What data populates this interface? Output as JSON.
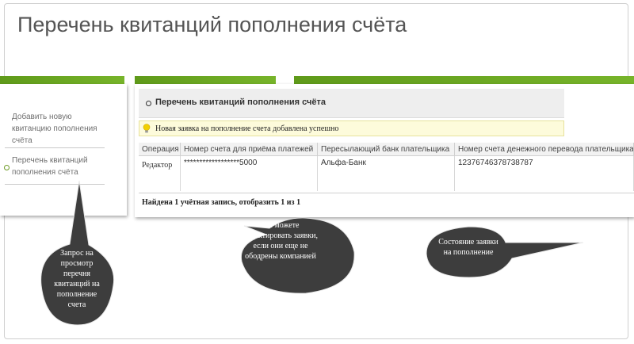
{
  "slide": {
    "title": "Перечень квитанций пополнения счёта"
  },
  "sidebar": {
    "items": [
      {
        "label": "Добавить новую квитанцию пополнения счёта"
      },
      {
        "label": "Перечень квитанций пополнения счёта"
      }
    ]
  },
  "panel": {
    "title": "Перечень квитанций пополнения счёта",
    "notice": "Новая заявка на пополнение счета добавлена успешно"
  },
  "table": {
    "headers": [
      "Операция",
      "Номер счета для приёма платежей",
      "Пересылающий банк плательщика",
      "Номер счета денежного перевода плательщика"
    ],
    "rows": [
      {
        "op": "Редактор",
        "account": "******************5000",
        "bank": "Альфа-Банк",
        "transfer": "12376746378738787"
      }
    ],
    "footer": "Найдена 1 учётная запись, отобразить 1 из 1"
  },
  "callouts": {
    "left": "Запрос на просмотр перечня квитанций на пополнение счета",
    "middle": "Вы можете редактировать заявки, если они еще не ободрены компанией",
    "right": "Состояние заявки на пополнение"
  },
  "colors": {
    "accent_green": "#6e9b25",
    "bubble_dark": "#3d3d3d",
    "notice_bg": "#fdfbdb"
  }
}
